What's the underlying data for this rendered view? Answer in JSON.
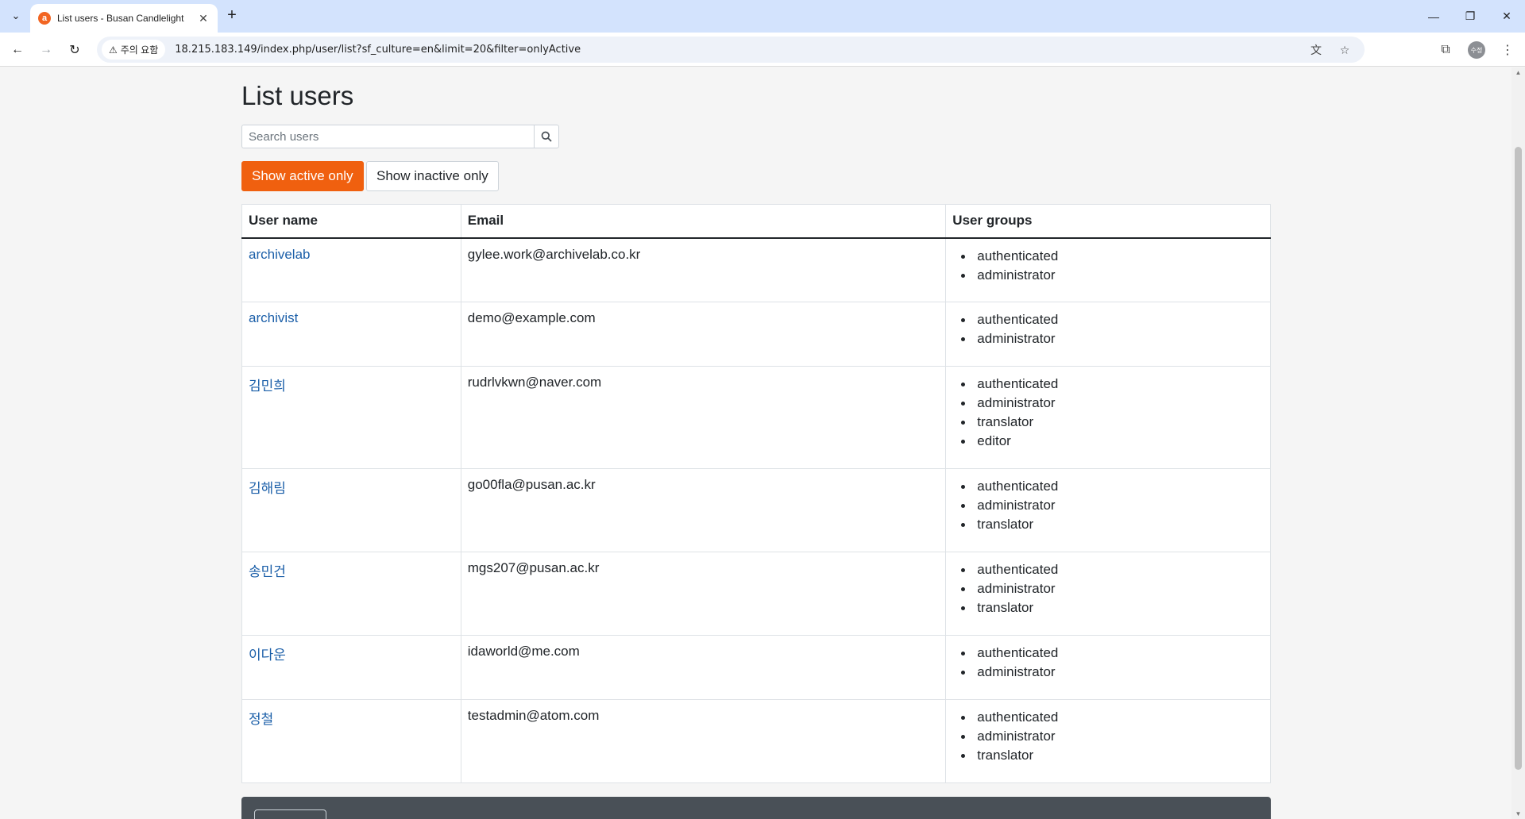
{
  "browser": {
    "tab_title": "List users - Busan Candlelight",
    "favicon_letter": "a",
    "security_label": "주의 요함",
    "url": "18.215.183.149/index.php/user/list?sf_culture=en&limit=20&filter=onlyActive",
    "profile_initials": "수정"
  },
  "page": {
    "title": "List users",
    "search_placeholder": "Search users",
    "filter_active_label": "Show active only",
    "filter_inactive_label": "Show inactive only",
    "accent_color": "#f0600f",
    "link_color": "#1a5ea8"
  },
  "table": {
    "headers": {
      "username": "User name",
      "email": "Email",
      "groups": "User groups"
    },
    "rows": [
      {
        "username": "archivelab",
        "email": "gylee.work@archivelab.co.kr",
        "groups": [
          "authenticated",
          "administrator"
        ]
      },
      {
        "username": "archivist",
        "email": "demo@example.com",
        "groups": [
          "authenticated",
          "administrator"
        ]
      },
      {
        "username": "김민희",
        "email": "rudrlvkwn@naver.com",
        "groups": [
          "authenticated",
          "administrator",
          "translator",
          "editor"
        ]
      },
      {
        "username": "김해림",
        "email": "go00fla@pusan.ac.kr",
        "groups": [
          "authenticated",
          "administrator",
          "translator"
        ]
      },
      {
        "username": "송민건",
        "email": "mgs207@pusan.ac.kr",
        "groups": [
          "authenticated",
          "administrator",
          "translator"
        ]
      },
      {
        "username": "이다운",
        "email": "idaworld@me.com",
        "groups": [
          "authenticated",
          "administrator"
        ]
      },
      {
        "username": "정철",
        "email": "testadmin@atom.com",
        "groups": [
          "authenticated",
          "administrator",
          "translator"
        ]
      }
    ]
  }
}
